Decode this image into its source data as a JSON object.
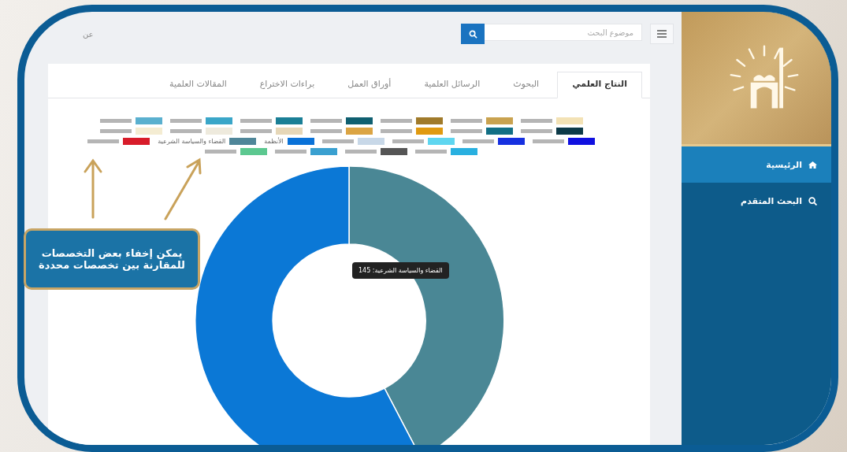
{
  "sidebar": {
    "items": [
      {
        "label": "الرئيسية",
        "selected": true
      },
      {
        "label": "البحث المتقدم",
        "selected": false
      }
    ]
  },
  "topbar": {
    "search": {
      "placeholder": "موضوع البحث"
    },
    "corner_text": "عن"
  },
  "tabs": [
    {
      "label": "النتاج العلمي",
      "selected": true
    },
    {
      "label": "البحوث",
      "selected": false
    },
    {
      "label": "الرسائل العلمية",
      "selected": false
    },
    {
      "label": "أوراق العمل",
      "selected": false
    },
    {
      "label": "براءات الاختراع",
      "selected": false
    },
    {
      "label": "المقالات العلمية",
      "selected": false
    }
  ],
  "legend": [
    {
      "color": "#f3e2b5",
      "hidden": true
    },
    {
      "color": "#c9a24f",
      "hidden": true
    },
    {
      "color": "#a07a2a",
      "hidden": true
    },
    {
      "color": "#0f5f70",
      "hidden": true
    },
    {
      "color": "#1a7f96",
      "hidden": true
    },
    {
      "color": "#3aa6c8",
      "hidden": true
    },
    {
      "color": "#5ab0cf",
      "hidden": true
    },
    {
      "color": "#0d3a48",
      "hidden": true
    },
    {
      "color": "#126f85",
      "hidden": true
    },
    {
      "color": "#e09a10",
      "hidden": true
    },
    {
      "color": "#dba443",
      "hidden": true
    },
    {
      "color": "#e6d7b8",
      "hidden": true
    },
    {
      "color": "#eeeadd",
      "hidden": true
    },
    {
      "color": "#f4ecd2",
      "hidden": true
    },
    {
      "color": "#1010e0",
      "hidden": true
    },
    {
      "color": "#1630e0",
      "hidden": true
    },
    {
      "color": "#5fd6f0",
      "hidden": true
    },
    {
      "color": "#c8d8e8",
      "hidden": true
    },
    {
      "color": "#0a72d8",
      "hidden": false,
      "label": "الأنظمة"
    },
    {
      "color": "#4f8699",
      "hidden": false,
      "label": "القضاء والسياسة الشرعية"
    },
    {
      "color": "#d81c2a",
      "hidden": true
    },
    {
      "color": "#29b0e0",
      "hidden": true
    },
    {
      "color": "#555555",
      "hidden": true
    },
    {
      "color": "#3aa0d0",
      "hidden": true
    },
    {
      "color": "#5cc890",
      "hidden": true
    }
  ],
  "tooltip": "القضاء والسياسة الشرعية: 145",
  "callout": "يمكن إخفاء بعض التخصصات للمقارنة بين تخصصات محددة"
}
